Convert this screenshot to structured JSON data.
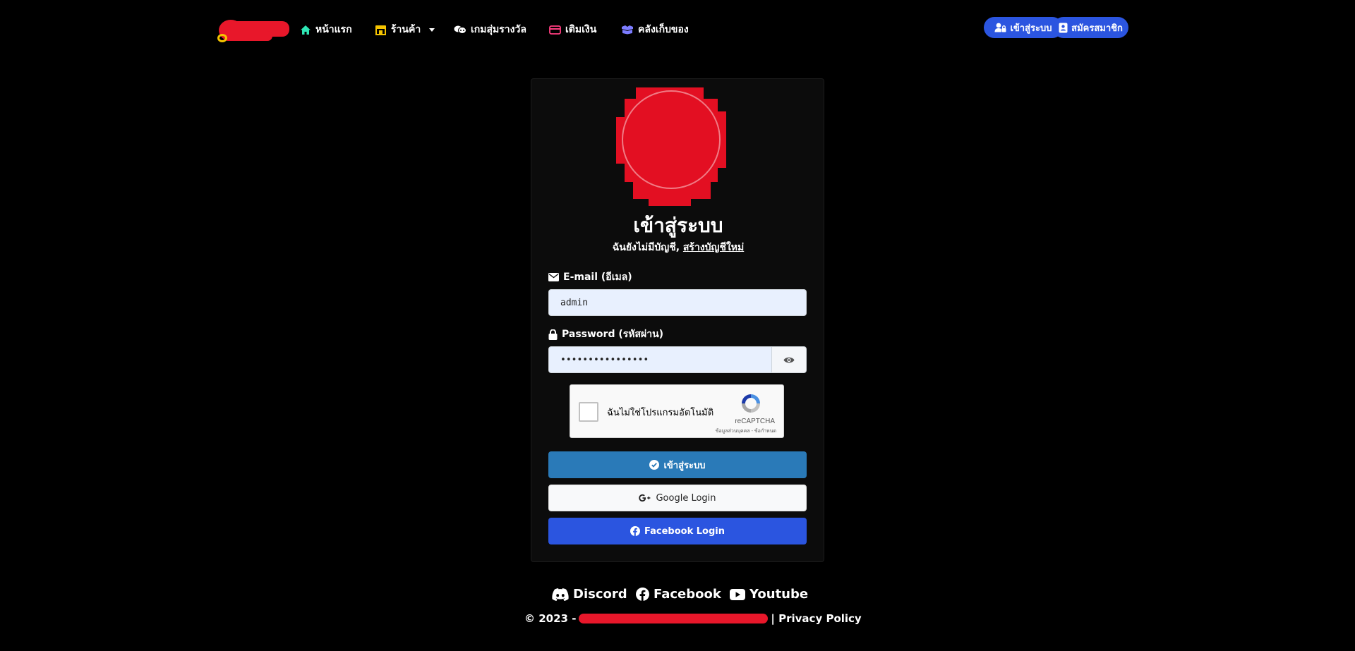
{
  "nav": {
    "items": [
      {
        "label": "หน้าแรก",
        "icon": "home-icon",
        "color": "#2ee6b5"
      },
      {
        "label": "ร้านค้า",
        "icon": "store-icon",
        "color": "#f5c400"
      },
      {
        "label": "เกมสุ่มรางวัล",
        "icon": "gamepad-icon",
        "color": "#ffffff"
      },
      {
        "label": "เติมเงิน",
        "icon": "credit-card-icon",
        "color": "#ff3d7f"
      },
      {
        "label": "คลังเก็บของ",
        "icon": "box-icon",
        "color": "#7c7cff"
      }
    ],
    "login_button": "เข้าสู่ระบบ",
    "register_button": "สมัครสมาชิก"
  },
  "login": {
    "title": "เข้าสู่ระบบ",
    "no_account_text": "ฉันยังไม่มีบัญชี,",
    "create_account_link": "สร้างบัญชีใหม่",
    "email_label": "E-mail (อีเมล)",
    "email_value": "admin",
    "password_label": "Password (รหัสผ่าน)",
    "password_value": "••••••••••••••••",
    "recaptcha_label": "ฉันไม่ใช่โปรแกรมอัตโนมัติ",
    "recaptcha_brand": "reCAPTCHA",
    "recaptcha_terms": "ข้อมูลส่วนบุคคล - ข้อกำหนด",
    "submit_button": "เข้าสู่ระบบ",
    "google_button": "Google Login",
    "facebook_button": "Facebook Login"
  },
  "footer": {
    "social": [
      {
        "label": "Discord",
        "icon": "discord-icon"
      },
      {
        "label": "Facebook",
        "icon": "facebook-icon"
      },
      {
        "label": "Youtube",
        "icon": "youtube-icon"
      }
    ],
    "copyright_prefix": "© 2023 -",
    "privacy_link": "| Privacy Policy"
  },
  "colors": {
    "background": "#000000",
    "card": "#0c0c0c",
    "primary_blue": "#2b55e0",
    "login_blue": "#2a7ab8",
    "input_bg": "#e8f0fe",
    "redaction_red": "#e8172a"
  }
}
